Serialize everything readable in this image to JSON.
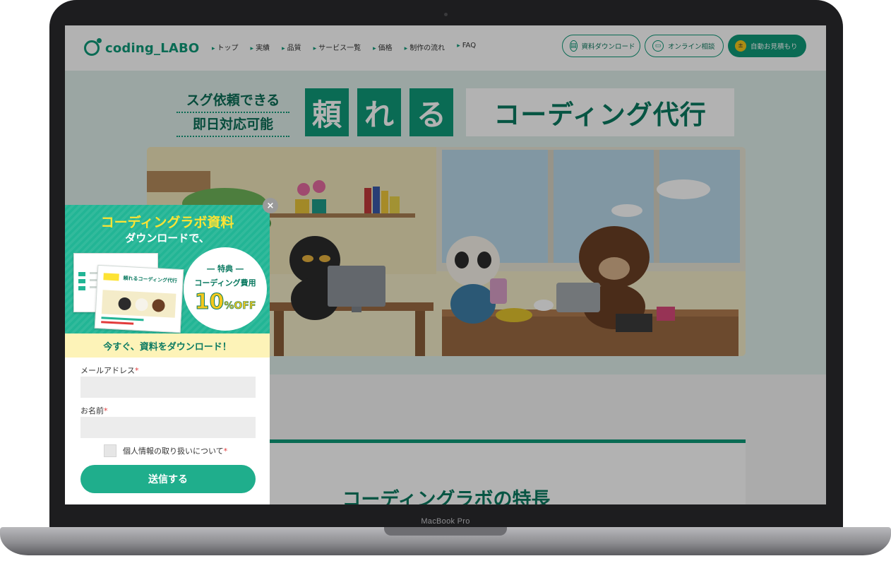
{
  "device": {
    "brand_label": "MacBook Pro"
  },
  "header": {
    "logo_text": "coding_LABO",
    "nav": [
      "トップ",
      "実績",
      "品質",
      "サービス一覧",
      "価格",
      "制作の流れ",
      "FAQ"
    ],
    "buttons": {
      "download": "資料ダウンロード",
      "online": "オンライン相談",
      "estimate": "自動お見積もり"
    }
  },
  "hero": {
    "sub_line1": "スグ依頼できる",
    "sub_line2": "即日対応可能",
    "kanji": [
      "頼",
      "れ",
      "る"
    ],
    "headline_rest": "コーディング代行"
  },
  "feature": {
    "title": "コーディングラボの特長"
  },
  "popup": {
    "title": "コーディングラボ資料",
    "subtitle": "ダウンロードで、",
    "benefit_label": "― 特典 ―",
    "benefit_text": "コーディング費用",
    "discount_number": "10",
    "discount_unit": "%OFF",
    "band_text": "今すぐ、資料をダウンロード！",
    "email_label": "メールアドレス",
    "name_label": "お名前",
    "required_mark": "*",
    "privacy_label": "個人情報の取り扱いについて",
    "submit_label": "送信する",
    "close_label": "×",
    "doc_front_title": "頼れるコーディング代行"
  },
  "colors": {
    "brand": "#0f9a79",
    "accent_yellow": "#fde334",
    "popup_green": "#22b595"
  }
}
